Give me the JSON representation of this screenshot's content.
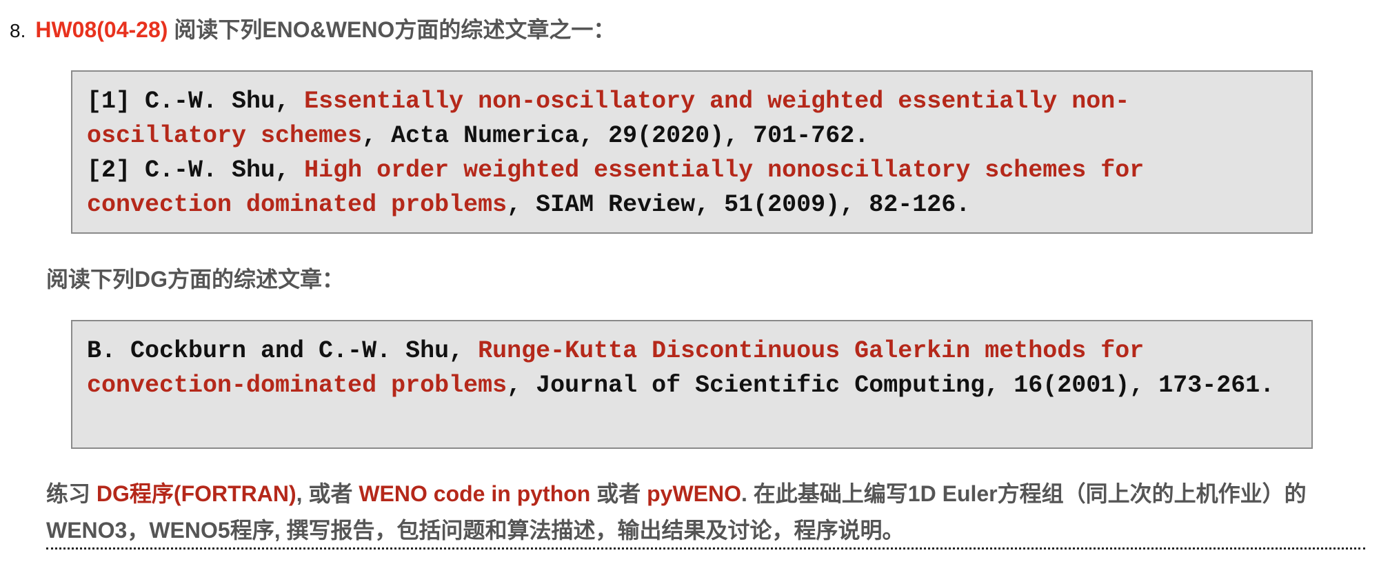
{
  "item_number": "8.",
  "title": {
    "code": "HW08(04-28)",
    "text": "阅读下列ENO&WENO方面的综述文章之一："
  },
  "refs1": [
    {
      "prefix": "[1] C.-W. Shu, ",
      "title": "Essentially non-oscillatory and weighted essentially non-oscillatory schemes",
      "suffix": ", Acta Numerica, 29(2020), 701-762."
    },
    {
      "prefix": "[2] C.-W. Shu, ",
      "title": "High order weighted essentially nonoscillatory schemes for convection dominated problems",
      "suffix": ", SIAM Review, 51(2009), 82-126."
    }
  ],
  "subheading": "阅读下列DG方面的综述文章：",
  "ref2": {
    "prefix": "B. Cockburn and C.-W. Shu, ",
    "title": "Runge-Kutta Discontinuous Galerkin methods for convection-dominated problems",
    "suffix": ", Journal of Scientific Computing, 16(2001), 173-261."
  },
  "exercise": {
    "t1": "练习 ",
    "link1": "DG程序(FORTRAN)",
    "t2": ", 或者 ",
    "link2": "WENO code in python",
    "t3": " 或者 ",
    "link3": "pyWENO",
    "t4": ". 在此基础上编写1D Euler方程组（同上次的上机作业）的WENO3，WENO5程序, 撰写报告，包括问题和算法描述，输出结果及讨论，程序说明。"
  }
}
